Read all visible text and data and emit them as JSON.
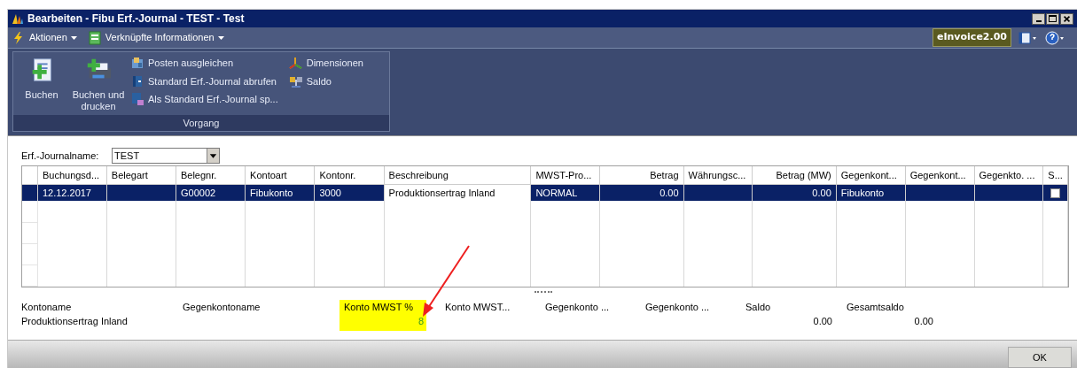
{
  "window": {
    "title": "Bearbeiten - Fibu Erf.-Journal - TEST - Test"
  },
  "menu": [
    {
      "label": "Aktionen",
      "kind": "bolt"
    },
    {
      "label": "Verknüpfte Informationen",
      "kind": "sheet"
    }
  ],
  "badge": "eInvoice2.00",
  "ribbon": {
    "group": "Vorgang",
    "large_actions": [
      {
        "label": "Buchen",
        "kind": "post"
      },
      {
        "label": "Buchen und drucken",
        "kind": "print"
      }
    ],
    "small_actions": [
      {
        "label": "Posten ausgleichen",
        "kind": "apply"
      },
      {
        "label": "Standard Erf.-Journal abrufen",
        "kind": "book"
      },
      {
        "label": "Als Standard Erf.-Journal sp...",
        "kind": "save"
      },
      {
        "label": "Dimensionen",
        "kind": "axes"
      },
      {
        "label": "Saldo",
        "kind": "balance"
      }
    ]
  },
  "journal_name": {
    "label": "Erf.-Journalname:",
    "value": "TEST"
  },
  "table": {
    "columns": [
      {
        "label": "Buchungsd...",
        "kind": "text"
      },
      {
        "label": "Belegart",
        "kind": "text"
      },
      {
        "label": "Belegnr.",
        "kind": "text"
      },
      {
        "label": "Kontoart",
        "kind": "text"
      },
      {
        "label": "Kontonr.",
        "kind": "text"
      },
      {
        "label": "Beschreibung",
        "kind": "text"
      },
      {
        "label": "MWST-Pro...",
        "kind": "text"
      },
      {
        "label": "Betrag",
        "kind": "amount"
      },
      {
        "label": "Währungsc...",
        "kind": "text"
      },
      {
        "label": "Betrag (MW)",
        "kind": "amount"
      },
      {
        "label": "Gegenkont...",
        "kind": "text"
      },
      {
        "label": "Gegenkont...",
        "kind": "text"
      },
      {
        "label": "Gegenkto. ...",
        "kind": "text"
      },
      {
        "label": "S...",
        "kind": "text"
      }
    ],
    "rows": [
      {
        "selected": true,
        "cells": [
          "12.12.2017",
          "",
          "G00002",
          "Fibukonto",
          "3000",
          "Produktionsertrag Inland",
          "NORMAL",
          "0.00",
          "",
          "0.00",
          "Fibukonto",
          "",
          ""
        ],
        "checked": false
      }
    ]
  },
  "footer": [
    {
      "label": "Kontoname",
      "value": "Produktionsertrag Inland",
      "highlighted": false
    },
    {
      "label": "Gegenkontoname",
      "highlighted": false
    },
    {
      "label": "Konto MWST %",
      "value": "8",
      "highlighted": true
    },
    {
      "label": "Konto MWST...",
      "highlighted": false
    },
    {
      "label": "Gegenkonto ...",
      "highlighted": false
    },
    {
      "label": "Gegenkonto ...",
      "highlighted": false
    },
    {
      "label": "Saldo",
      "value": "0.00",
      "highlighted": false
    },
    {
      "label": "Gesamtsaldo",
      "value": "0.00",
      "highlighted": false
    }
  ],
  "ok_button": "OK"
}
